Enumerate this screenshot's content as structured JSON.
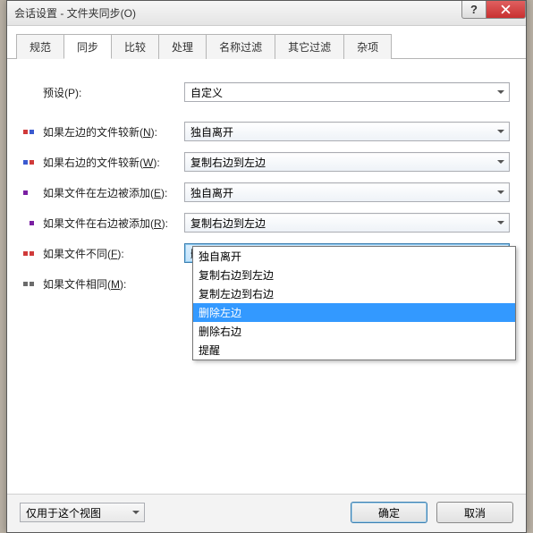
{
  "window": {
    "title": "会话设置 - 文件夹同步(O)"
  },
  "tabs": [
    "规范",
    "同步",
    "比较",
    "处理",
    "名称过滤",
    "其它过滤",
    "杂项"
  ],
  "active_tab": 1,
  "preset": {
    "label": "预设(P):",
    "value": "自定义"
  },
  "rows": [
    {
      "color1": "#d03a3a",
      "color2": "#3a5ad0",
      "label_pre": "如果左边的文件较新(",
      "key": "N",
      "label_post": "):",
      "value": "独自离开"
    },
    {
      "color1": "#3a5ad0",
      "color2": "#d03a3a",
      "label_pre": "如果右边的文件较新(",
      "key": "W",
      "label_post": "):",
      "value": "复制右边到左边"
    },
    {
      "color1": "#7a1fa2",
      "color2": "",
      "label_pre": "如果文件在左边被添加(",
      "key": "E",
      "label_post": "):",
      "value": "独自离开"
    },
    {
      "color1": "",
      "color2": "#7a1fa2",
      "label_pre": "如果文件在右边被添加(",
      "key": "R",
      "label_post": "):",
      "value": "复制右边到左边"
    },
    {
      "color1": "#d03a3a",
      "color2": "#d03a3a",
      "label_pre": "如果文件不同(",
      "key": "F",
      "label_post": "):",
      "value": "删除左边",
      "open": true
    },
    {
      "color1": "#6b6b6b",
      "color2": "#6b6b6b",
      "label_pre": "如果文件相同(",
      "key": "M",
      "label_post": "):",
      "value": ""
    }
  ],
  "dropdown": {
    "options": [
      "独自离开",
      "复制右边到左边",
      "复制左边到右边",
      "删除左边",
      "删除右边",
      "提醒"
    ],
    "selected": "删除左边"
  },
  "footer": {
    "view_label": "仅用于这个视图",
    "ok": "确定",
    "cancel": "取消"
  }
}
